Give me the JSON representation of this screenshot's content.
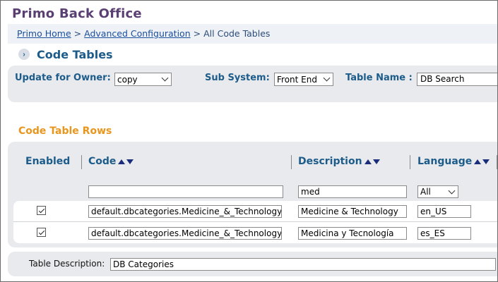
{
  "app": {
    "title": "Primo Back Office"
  },
  "breadcrumb": {
    "home": "Primo Home",
    "separator": ">",
    "advanced": "Advanced Configuration",
    "current": "All Code Tables"
  },
  "section": {
    "title": "Code Tables",
    "expand_icon": "chevron-right-icon"
  },
  "filters": {
    "owner_label": "Update for Owner:",
    "owner_value": "copy",
    "subsystem_label": "Sub System:",
    "subsystem_value": "Front End",
    "table_name_label": "Table Name :",
    "table_name_value": "DB Search"
  },
  "rows_heading": "Code Table Rows",
  "table": {
    "columns": {
      "enabled": "Enabled",
      "code": "Code",
      "description": "Description",
      "language": "Language"
    },
    "filter_row": {
      "code": "",
      "description": "med",
      "language": "All"
    },
    "rows": [
      {
        "enabled": true,
        "code": "default.dbcategories.Medicine_&_Technology",
        "description": "Medicine & Technology",
        "language": "en_US"
      },
      {
        "enabled": true,
        "code": "default.dbcategories.Medicine_&_Technology",
        "description": "Medicina y Tecnología",
        "language": "es_ES"
      }
    ]
  },
  "table_description": {
    "label": "Table Description:",
    "value": "DB Categories"
  },
  "colors": {
    "title": "#5a3f73",
    "heading_blue": "#1d5c8a",
    "orange_heading": "#e8961e",
    "panel_gray": "#e8eaed",
    "link_blue": "#1a4f9c"
  }
}
